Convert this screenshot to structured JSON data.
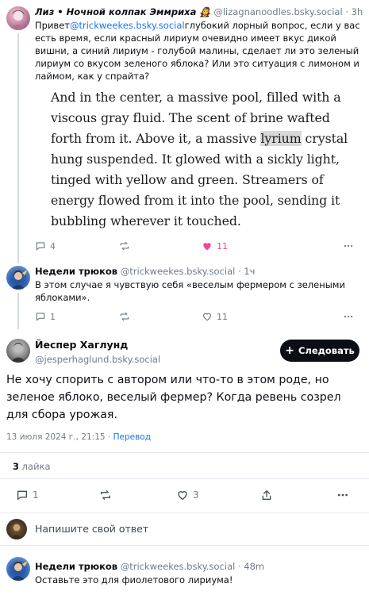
{
  "post1": {
    "name": "Лиз • Ночной колпак Эммриха 🧛‍♀️",
    "handle": "@lizagnanoodles.bsky.social",
    "time": "· 3h",
    "text_prefix": "Привет",
    "mention": "@trickweekes.bsky.social",
    "text_rest": "глубокий лорный вопрос, если у вас есть время, если красный лириум очевидно имеет вкус дикой вишни, а синий лириум - голубой малины, сделает ли это зеленый лириум со вкусом зеленого яблока? Или это ситуация с лимоном и лаймом, как у спрайта?",
    "image_text_before": "And in the center, a massive pool, filled with a viscous gray fluid. The scent of brine wafted forth from it. Above it, a massive ",
    "image_text_highlight": "lyrium",
    "image_text_after": " crystal hung suspended. It glowed with a sickly light, tinged with yellow and green. Streamers of energy flowed from it into the pool, sending it bubbling wherever it touched.",
    "replies": "4",
    "likes": "11"
  },
  "post2": {
    "name": "Недели трюков",
    "handle": "@trickweekes.bsky.social",
    "time": "· 1ч",
    "text": "В этом случае я чувствую себя «веселым фермером с зелеными яблоками».",
    "replies": "1",
    "likes": "11"
  },
  "main": {
    "name": "Йеспер Хаглунд",
    "handle": "@jesperhaglund.bsky.social",
    "follow_label": "Следовать",
    "text": "Не хочу спорить с автором или что-то в этом роде, но зеленое яблоко, веселый фермер? Когда ревень созрел для сбора урожая.",
    "date": "13 июля 2024 г., 21:15",
    "translate": "Перевод",
    "likes_count": "3",
    "likes_label": "лайка",
    "replies": "1",
    "likes": "3"
  },
  "composer": {
    "placeholder": "Напишите свой ответ"
  },
  "reply": {
    "name": "Недели трюков",
    "handle": "@trickweekes.bsky.social",
    "time": "· 48m",
    "text": "Оставьте это для фиолетового лириума!"
  },
  "colors": {
    "accent": "#1a73e8",
    "like": "#ec4899",
    "muted": "#6f7c88"
  }
}
